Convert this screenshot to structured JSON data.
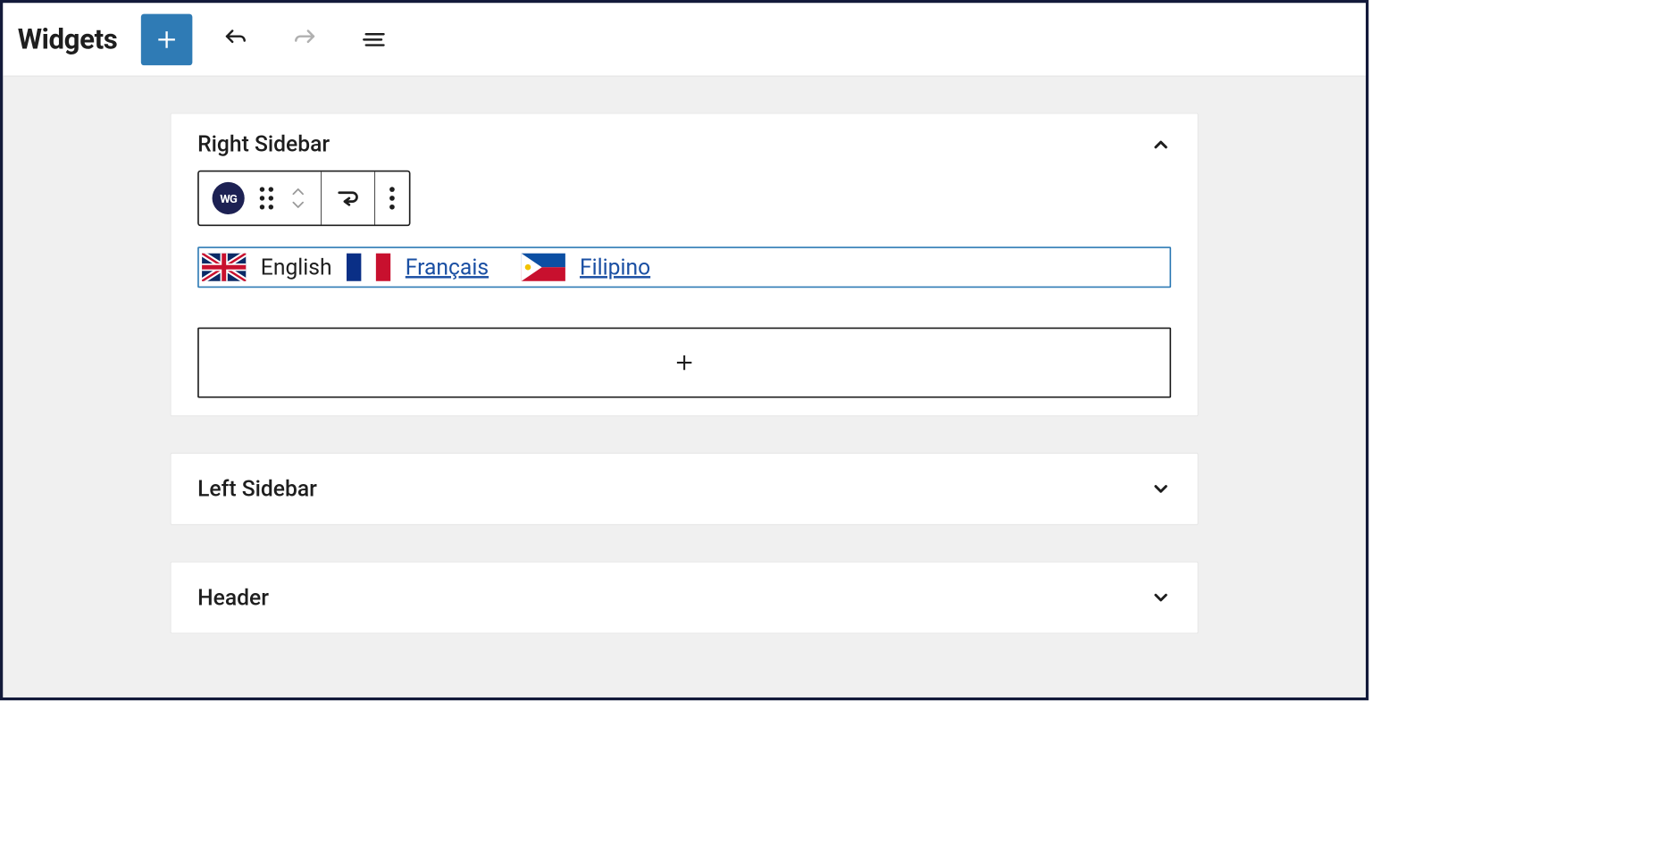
{
  "header": {
    "title": "Widgets"
  },
  "icons": {
    "plus": "plus-icon",
    "undo": "undo-icon",
    "redo": "redo-icon",
    "list_view": "list-view-icon",
    "chevron_up": "chevron-up-icon",
    "chevron_down": "chevron-down-icon",
    "drag": "drag-icon",
    "move_up": "move-up-icon",
    "move_down": "move-down-icon",
    "move_to": "move-to-icon",
    "kebab": "kebab-icon"
  },
  "blockToolbar": {
    "badge": "WG"
  },
  "panels": {
    "right_sidebar": {
      "title": "Right Sidebar",
      "expanded": true
    },
    "left_sidebar": {
      "title": "Left Sidebar",
      "expanded": false
    },
    "header_area": {
      "title": "Header",
      "expanded": false
    }
  },
  "langBlock": {
    "items": [
      {
        "label": "English",
        "link": false
      },
      {
        "label": "Français",
        "link": true
      },
      {
        "label": "Filipino",
        "link": true
      }
    ]
  },
  "colors": {
    "primary": "#2f7bb5",
    "link": "#1a4fa3",
    "badge_bg": "#1d2153"
  }
}
